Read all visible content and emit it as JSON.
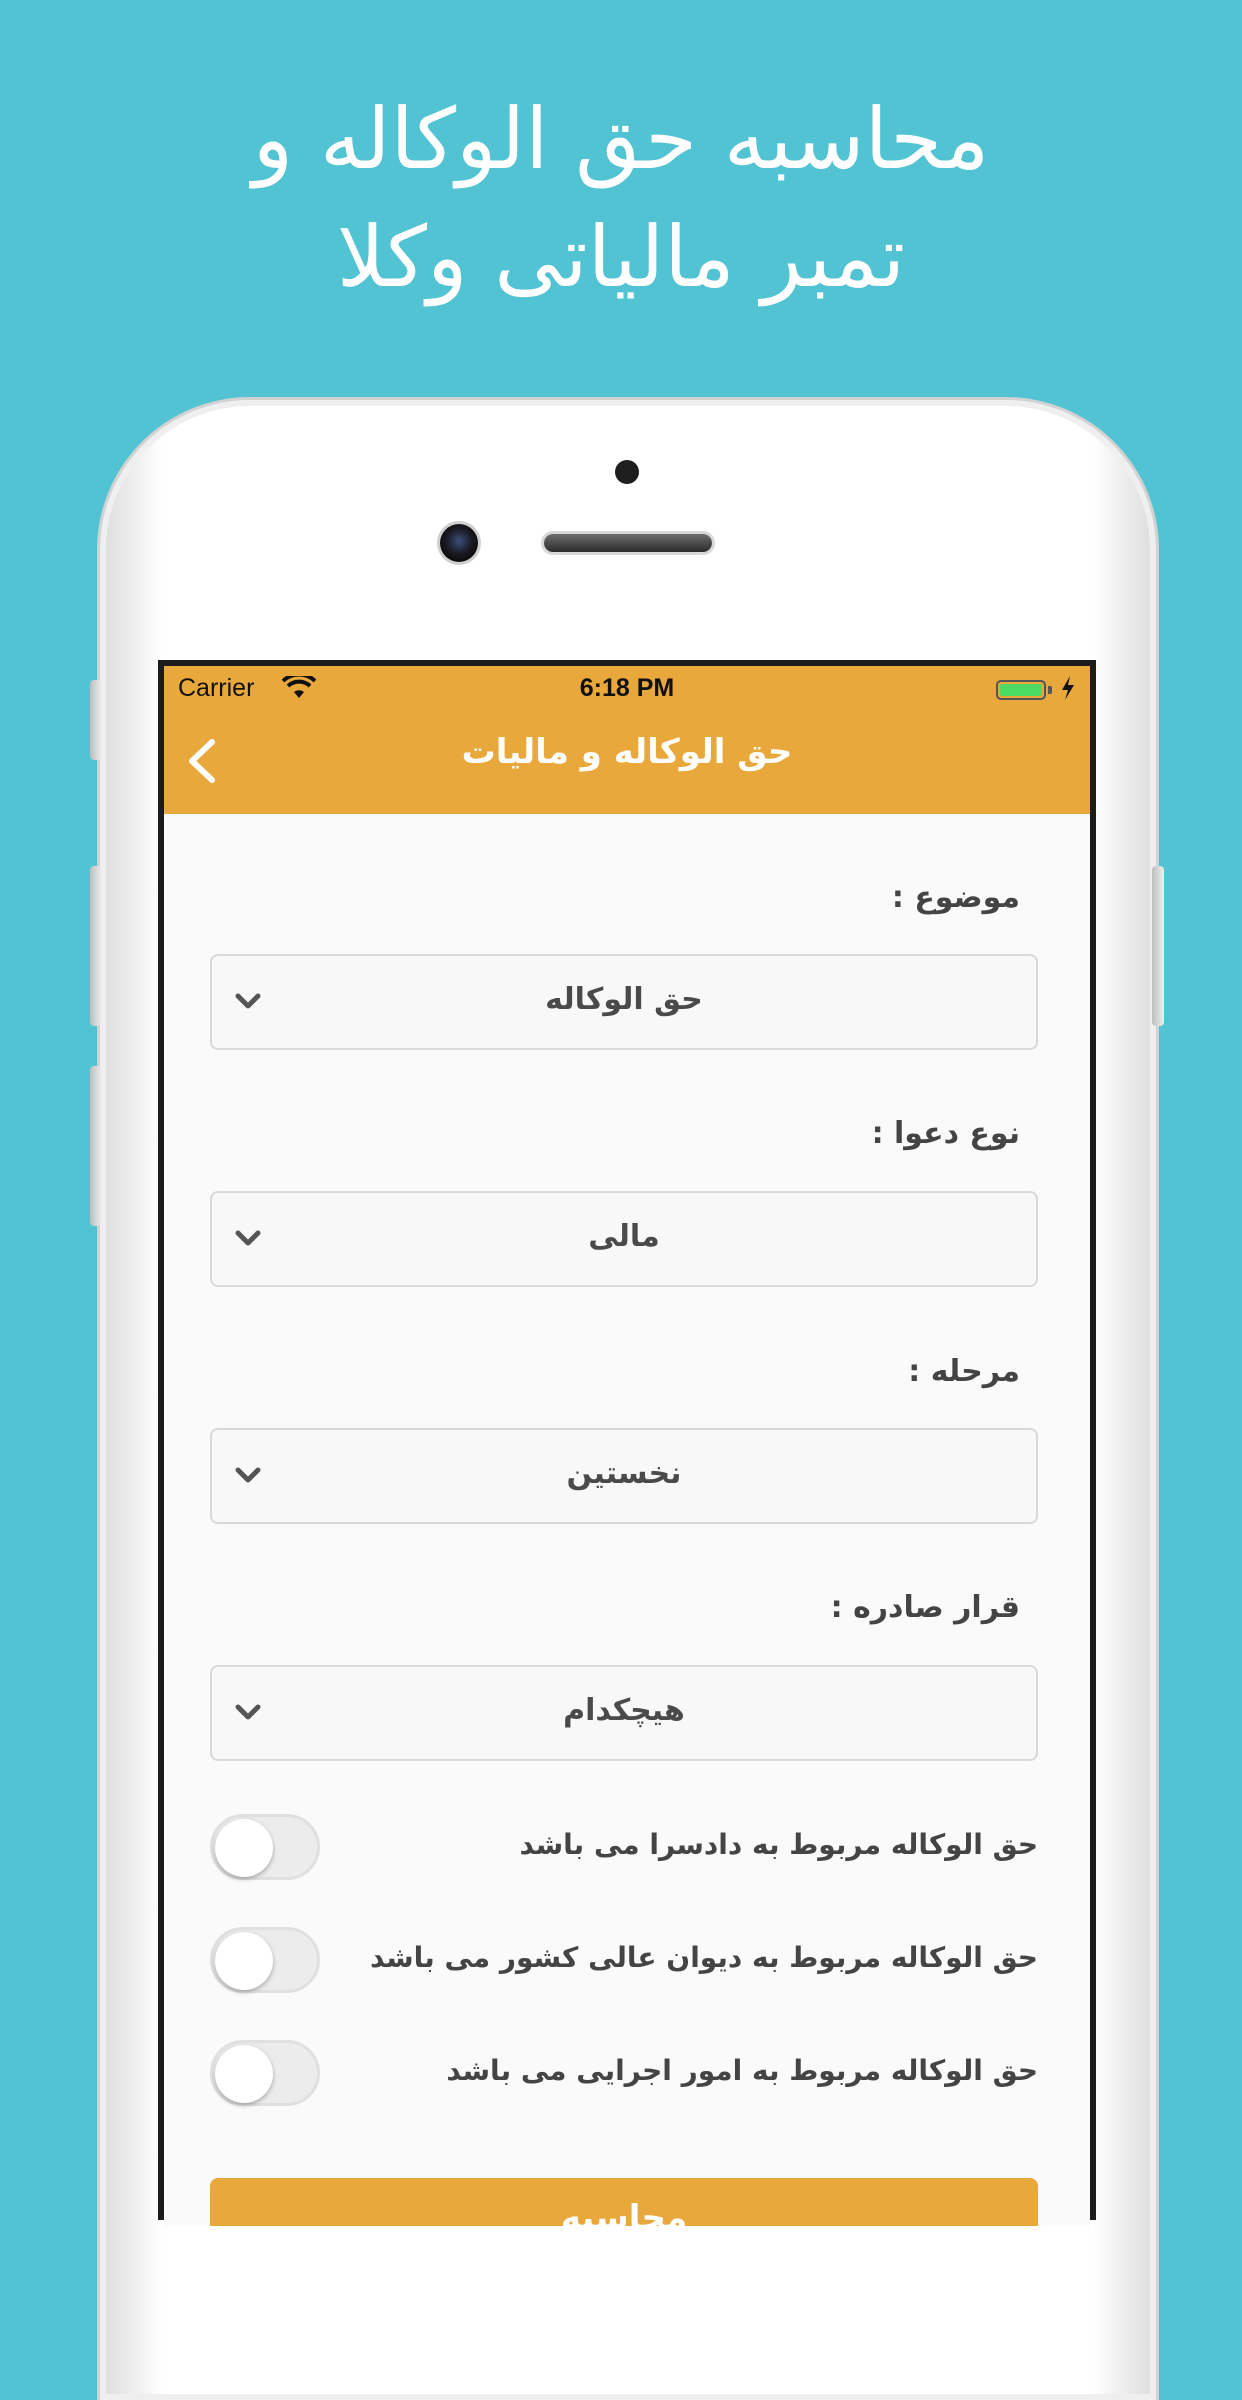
{
  "promo": {
    "line1": "محاسبه حق الوکاله و",
    "line2": "تمبر مالیاتی وکلا"
  },
  "status_bar": {
    "carrier": "Carrier",
    "time": "6:18 PM",
    "battery_level": 1.0
  },
  "navbar": {
    "title": "حق الوکاله و مالیات",
    "back_icon": "chevron-left-icon"
  },
  "form": {
    "fields": [
      {
        "label": "موضوع :",
        "value": "حق الوکاله"
      },
      {
        "label": "نوع دعوا :",
        "value": "مالی"
      },
      {
        "label": "مرحله :",
        "value": "نخستین"
      },
      {
        "label": "قرار صادره :",
        "value": "هیچکدام"
      }
    ],
    "toggles": [
      {
        "label": "حق الوکاله مربوط به دادسرا می باشد",
        "on": false
      },
      {
        "label": "حق الوکاله مربوط به دیوان عالی کشور می باشد",
        "on": false
      },
      {
        "label": "حق الوکاله مربوط به امور اجرایی می باشد",
        "on": false
      }
    ],
    "submit_label": "محاسبه"
  },
  "colors": {
    "background": "#52c3d3",
    "accent": "#e9a83b"
  }
}
